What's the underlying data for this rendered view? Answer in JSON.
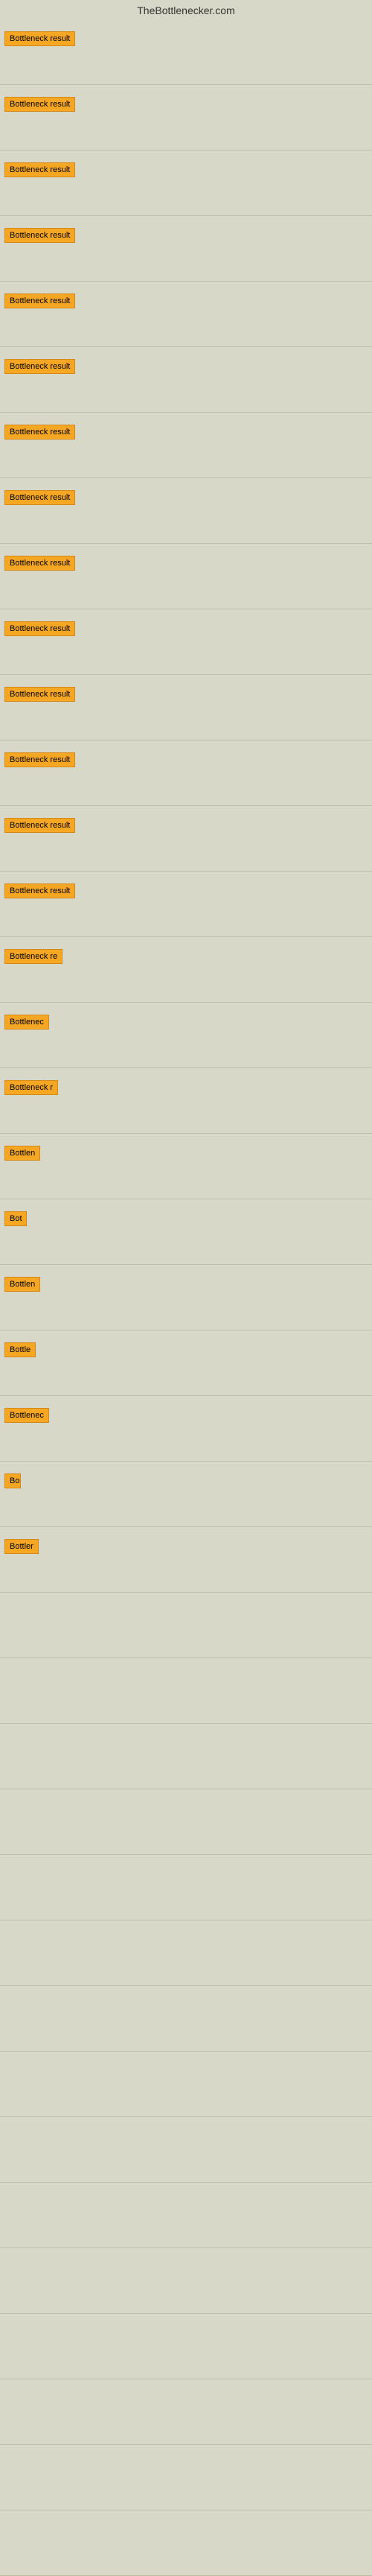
{
  "header": {
    "title": "TheBottlenecker.com"
  },
  "rows": [
    {
      "id": 1,
      "label": "Bottleneck result",
      "width": "full"
    },
    {
      "id": 2,
      "label": "Bottleneck result",
      "width": "full"
    },
    {
      "id": 3,
      "label": "Bottleneck result",
      "width": "full"
    },
    {
      "id": 4,
      "label": "Bottleneck result",
      "width": "full"
    },
    {
      "id": 5,
      "label": "Bottleneck result",
      "width": "full"
    },
    {
      "id": 6,
      "label": "Bottleneck result",
      "width": "full"
    },
    {
      "id": 7,
      "label": "Bottleneck result",
      "width": "full"
    },
    {
      "id": 8,
      "label": "Bottleneck result",
      "width": "full"
    },
    {
      "id": 9,
      "label": "Bottleneck result",
      "width": "full"
    },
    {
      "id": 10,
      "label": "Bottleneck result",
      "width": "full"
    },
    {
      "id": 11,
      "label": "Bottleneck result",
      "width": "full"
    },
    {
      "id": 12,
      "label": "Bottleneck result",
      "width": "full"
    },
    {
      "id": 13,
      "label": "Bottleneck result",
      "width": "full"
    },
    {
      "id": 14,
      "label": "Bottleneck result",
      "width": "full"
    },
    {
      "id": 15,
      "label": "Bottleneck re",
      "width": "partial"
    },
    {
      "id": 16,
      "label": "Bottlenec",
      "width": "small"
    },
    {
      "id": 17,
      "label": "Bottleneck r",
      "width": "partial2"
    },
    {
      "id": 18,
      "label": "Bottlen",
      "width": "smaller"
    },
    {
      "id": 19,
      "label": "Bot",
      "width": "tiny"
    },
    {
      "id": 20,
      "label": "Bottlen",
      "width": "smaller"
    },
    {
      "id": 21,
      "label": "Bottle",
      "width": "smaller2"
    },
    {
      "id": 22,
      "label": "Bottlenec",
      "width": "small"
    },
    {
      "id": 23,
      "label": "Bo",
      "width": "tiniest"
    },
    {
      "id": 24,
      "label": "Bottler",
      "width": "smaller3"
    }
  ],
  "empty_rows": [
    1,
    2,
    3,
    4,
    5,
    6,
    7,
    8,
    9,
    10,
    11,
    12,
    13,
    14,
    15
  ]
}
